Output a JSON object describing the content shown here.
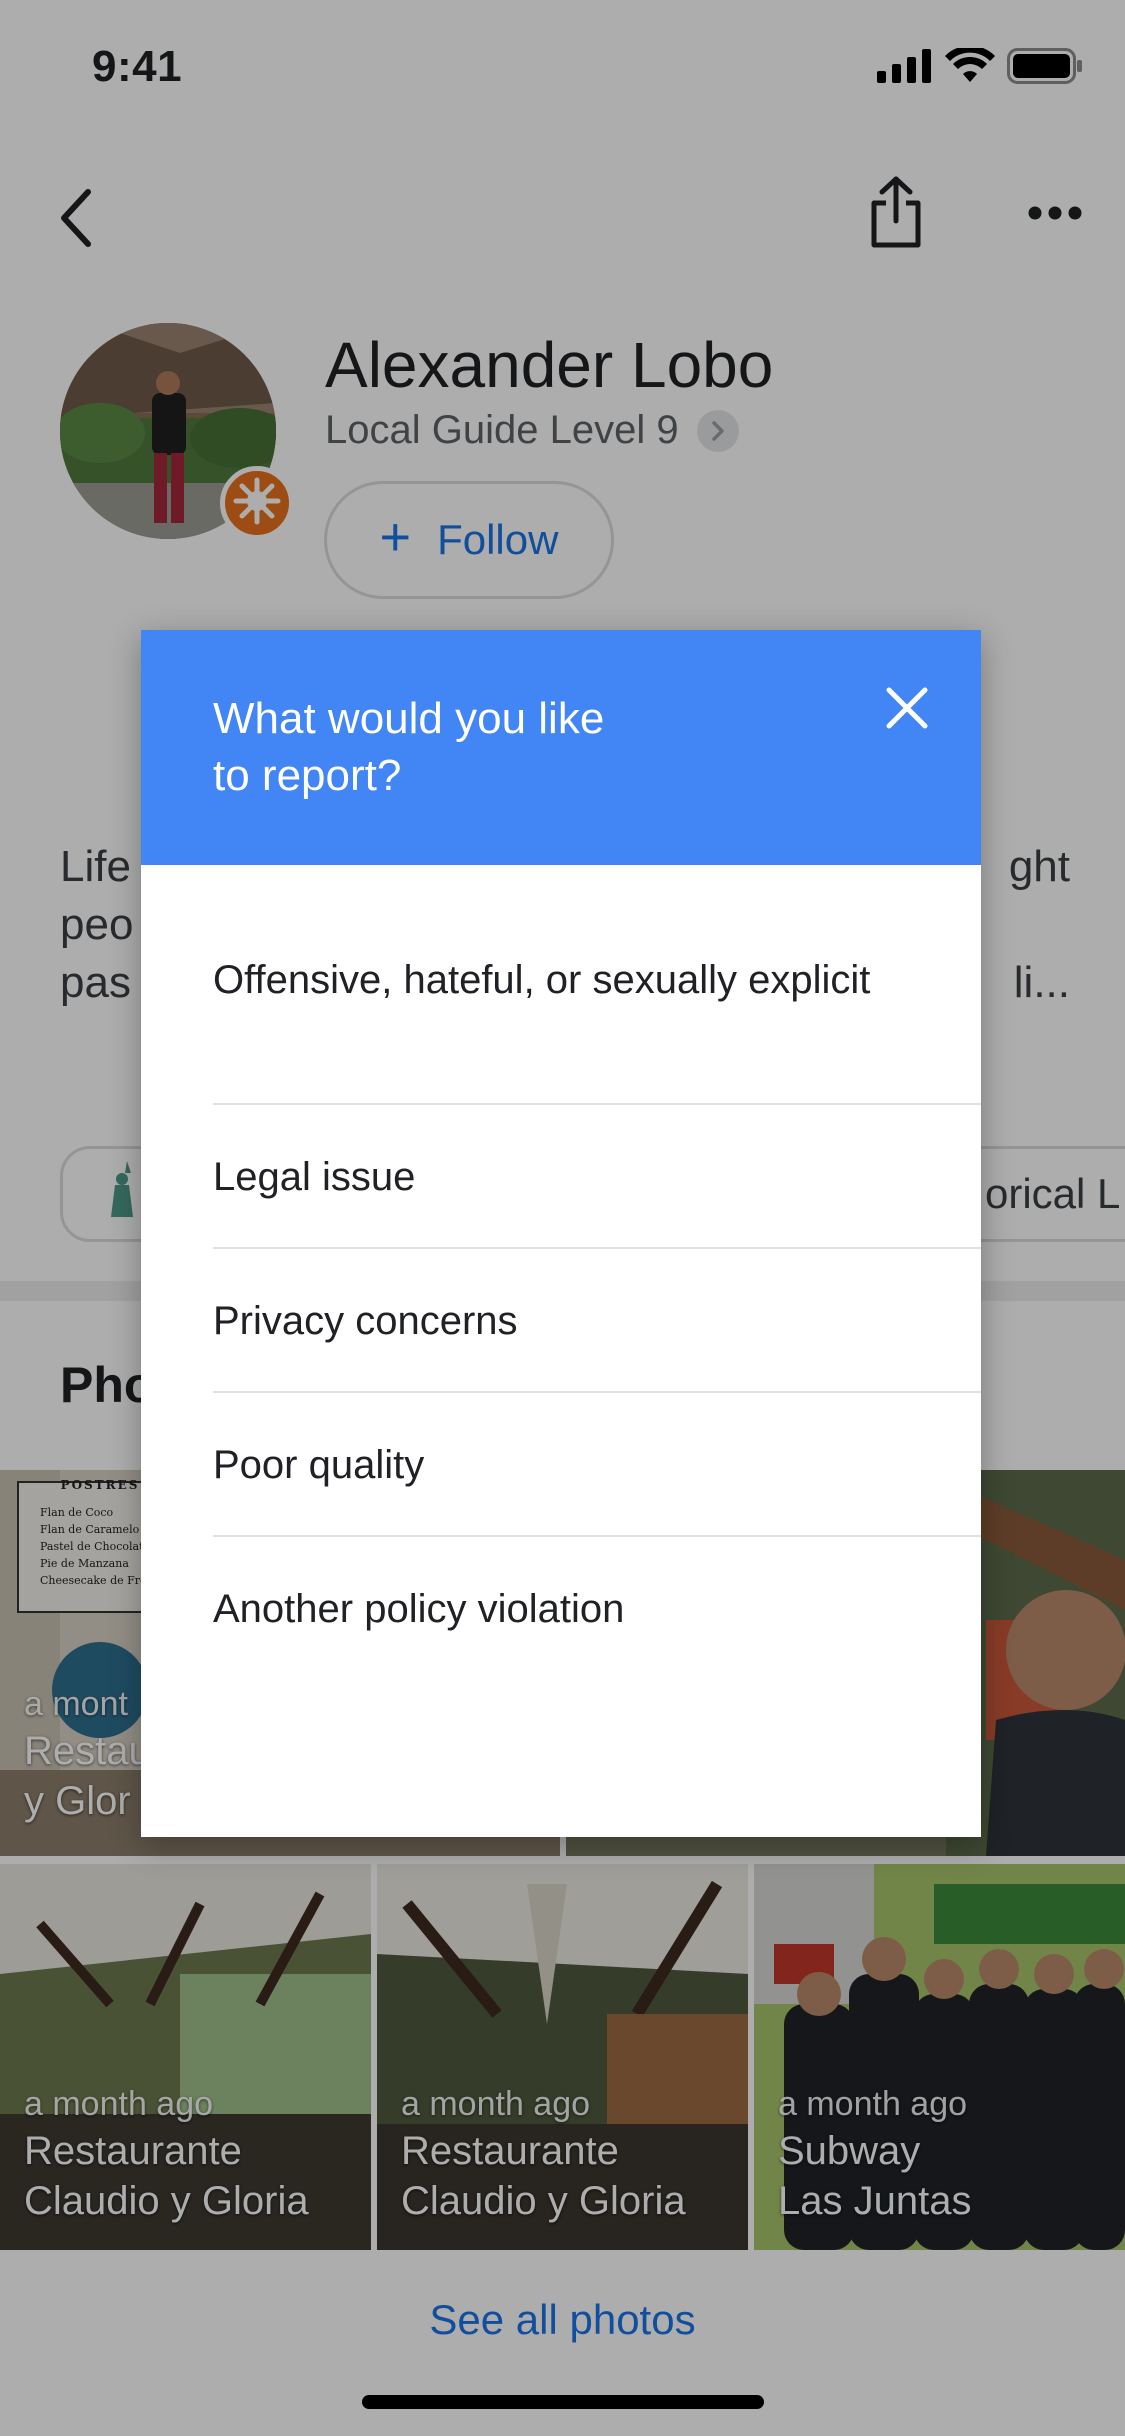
{
  "status_bar": {
    "time": "9:41"
  },
  "toolbar": {
    "back_icon": "chevron-left-icon",
    "share_icon": "share-icon",
    "more_icon": "more-horizontal-icon"
  },
  "profile": {
    "name": "Alexander Lobo",
    "level": "Local Guide Level 9",
    "follow_label": "Follow",
    "badge_color": "#e8711c"
  },
  "bio": {
    "line1_start": "Life",
    "line1_end": "ght",
    "line2_start": "peo",
    "line3_start": "pas",
    "line3_end": "li..."
  },
  "chips": {
    "right_chip_text": "orical L"
  },
  "photos": {
    "heading": "Pho",
    "top_row": [
      {
        "date": "a mont",
        "title_line1": "Restau",
        "title_line2": "y Glor"
      }
    ],
    "bottom_row": [
      {
        "date": "a month ago",
        "title_line1": "Restaurante",
        "title_line2": "Claudio y Gloria"
      },
      {
        "date": "a month ago",
        "title_line1": "Restaurante",
        "title_line2": "Claudio y Gloria"
      },
      {
        "date": "a month ago",
        "title_line1": "Subway",
        "title_line2": "Las Juntas"
      }
    ],
    "menu_sign": {
      "heading": "POSTRES",
      "items": [
        "Flan de Coco",
        "Flan de Caramelo",
        "Pastel de Chocolate",
        "Pie de Manzana",
        "Cheesecake de Fresa"
      ]
    },
    "see_all_label": "See all photos"
  },
  "dialog": {
    "title_line1": "What would you like",
    "title_line2": "to report?",
    "header_color": "#4285f4",
    "options": [
      "Offensive, hateful, or sexually explicit",
      "Legal issue",
      "Privacy concerns",
      "Poor quality",
      "Another policy violation"
    ]
  },
  "colors": {
    "accent": "#1a73e8",
    "scrim": "rgba(0,0,0,0.32)"
  }
}
